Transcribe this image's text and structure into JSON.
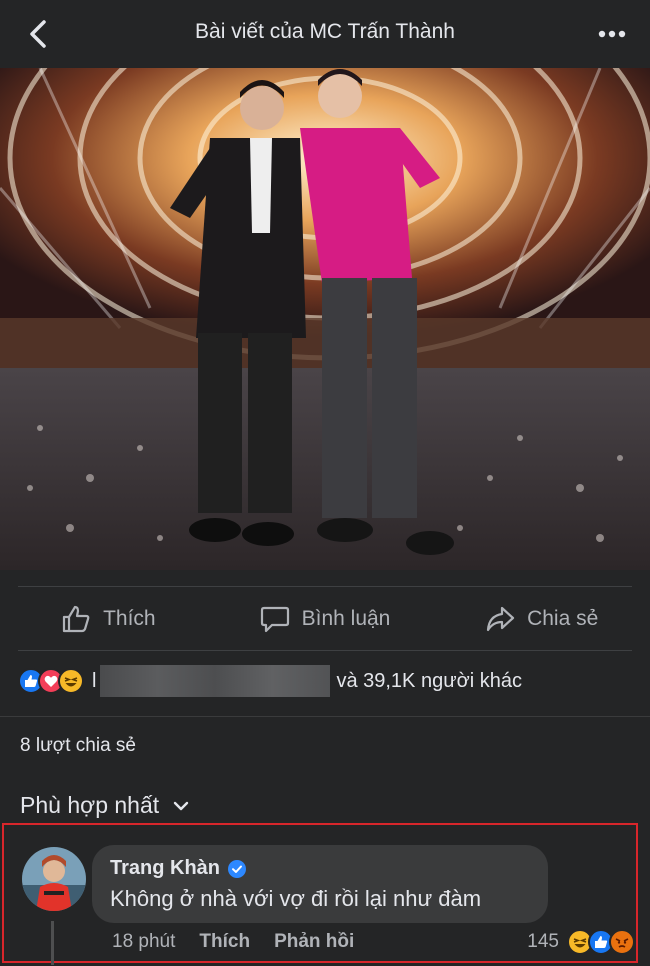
{
  "header": {
    "title": "Bài viết của MC Trấn Thành"
  },
  "actions": {
    "like": "Thích",
    "comment": "Bình luận",
    "share": "Chia sẻ"
  },
  "reactions": {
    "prefix": "l",
    "summary": "và 39,1K người khác"
  },
  "shares": "8 lượt chia sẻ",
  "sort": {
    "label": "Phù hợp nhất"
  },
  "comment": {
    "author": "Trang Khàn",
    "text": "Không ở nhà với vợ đi rồi lại như đàm",
    "time": "18 phút",
    "like_label": "Thích",
    "reply_label": "Phản hồi",
    "reaction_count": "145"
  },
  "colors": {
    "background": "#242526",
    "bubble": "#3a3b3c",
    "highlight_border": "#d8262b",
    "like_blue": "#1877f2",
    "love_red": "#f33e58"
  }
}
